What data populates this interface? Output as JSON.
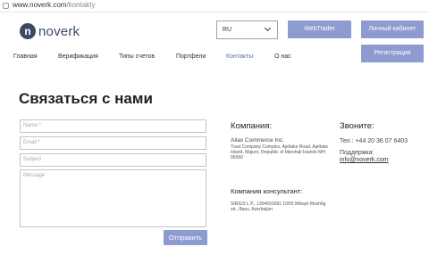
{
  "browser": {
    "url_host": "www.noverk.com",
    "url_path": "/kontakty"
  },
  "header": {
    "logo_letter": "n",
    "logo_text": "noverk",
    "language": "RU",
    "webtrader_label": "WebTrader",
    "cabinet_label": "Личный кабинет",
    "register_label": "Регистрация"
  },
  "nav": {
    "items": [
      {
        "label": "Главная"
      },
      {
        "label": "Верификация"
      },
      {
        "label": "Типы счетов"
      },
      {
        "label": "Портфели"
      },
      {
        "label": "Контакты",
        "active": true
      },
      {
        "label": "О нас"
      }
    ],
    "active_color": "#5b6fb5"
  },
  "page": {
    "title": "Связаться с нами"
  },
  "form": {
    "name_placeholder": "Name *",
    "email_placeholder": "Email *",
    "subject_placeholder": "Subject",
    "message_placeholder": "Message",
    "submit_label": "Отправить"
  },
  "company": {
    "title": "Компания:",
    "name": "Allax Commerce Inc.",
    "address": "Trust Company Complex, Ajeltake Road, Ajeltake Island, Majuro, Republic of Marshall Islands MH 96960"
  },
  "consultant": {
    "title": "Компания консультант:",
    "text": "SIRIUS L.P., 1304691681 10/55 Mikayil Mushfig str., Basu, Azerbaijan"
  },
  "contact": {
    "title": "Звоните:",
    "phone": "Тел.: +44 20 36 07 6403",
    "support_label": "Поддержка:",
    "support_email": "info@noverk.com"
  },
  "colors": {
    "accent": "#8e9bd0",
    "logo": "#3b4a63"
  }
}
